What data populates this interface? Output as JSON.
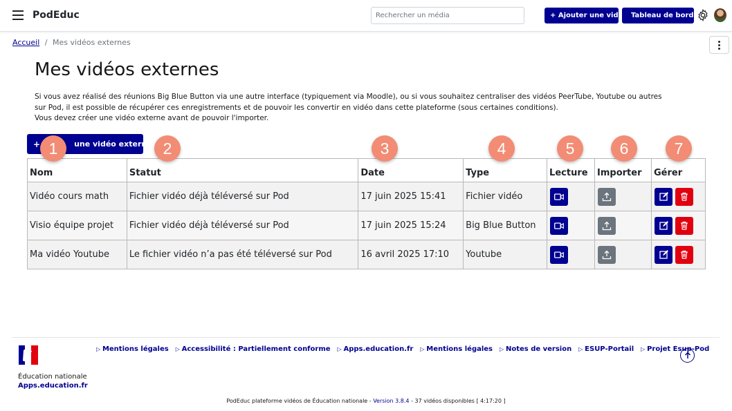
{
  "header": {
    "brand": "PodEduc",
    "search_placeholder": "Rechercher un média",
    "add_video": "+ Ajouter une vidéo",
    "dashboard": "Tableau de bord"
  },
  "breadcrumb": {
    "home": "Accueil",
    "separator": "/",
    "current": "Mes vidéos externes"
  },
  "page": {
    "title": "Mes vidéos externes",
    "intro_lines": [
      "Si vous avez réalisé des réunions Big Blue Button via une autre interface (typiquement via Moodle), ou si vous souhaitez centraliser des vidéos PeerTube, Youtube ou autres",
      "sur Pod, il est possible de récupérer ces enregistrements et de pouvoir les convertir en vidéo dans cette plateforme (sous certaines conditions).",
      "Vous devez créer une vidéo externe avant de pouvoir l'importer."
    ],
    "create_button": {
      "plus": "+",
      "label": "une vidéo externe"
    }
  },
  "markers": [
    "1",
    "2",
    "3",
    "4",
    "5",
    "6",
    "7"
  ],
  "table": {
    "headers": [
      "Nom",
      "Statut",
      "Date",
      "Type",
      "Lecture",
      "Importer",
      "Gérer"
    ],
    "rows": [
      {
        "nom": "Vidéo cours math",
        "statut": "Fichier vidéo déjà téléversé sur Pod",
        "date": "17 juin 2025 15:41",
        "type": "Fichier vidéo"
      },
      {
        "nom": "Visio équipe projet",
        "statut": "Fichier vidéo déjà téléversé sur Pod",
        "date": "17 juin 2025 15:24",
        "type": "Big Blue Button"
      },
      {
        "nom": "Ma vidéo Youtube",
        "statut": "Le fichier vidéo n’a pas été téléversé sur Pod",
        "date": "16 avril 2025 17:10",
        "type": "Youtube"
      }
    ]
  },
  "footer": {
    "links": [
      "Mentions légales",
      "Accessibilité : Partiellement conforme",
      "Apps.education.fr",
      "Mentions légales",
      "Notes de version",
      "ESUP-Portail",
      "Projet Esup-Pod"
    ],
    "org_name": "Éducation nationale",
    "org_link": "Apps.education.fr",
    "bottom_prefix": "PodEduc plateforme vidéos de Éducation nationale - ",
    "version": "Version 3.8.4",
    "bottom_suffix": " - 37 vidéos disponibles [ 4:17:20 ]"
  },
  "colors": {
    "primary": "#000091",
    "danger": "#e1000f",
    "secondary": "#6c757d",
    "marker": "#f28c74"
  },
  "icons": [
    "menu-icon",
    "settings-icon",
    "film-icon",
    "video-camera-icon",
    "upload-icon",
    "edit-icon",
    "trash-icon",
    "arrow-up-icon",
    "marianne-logo"
  ]
}
